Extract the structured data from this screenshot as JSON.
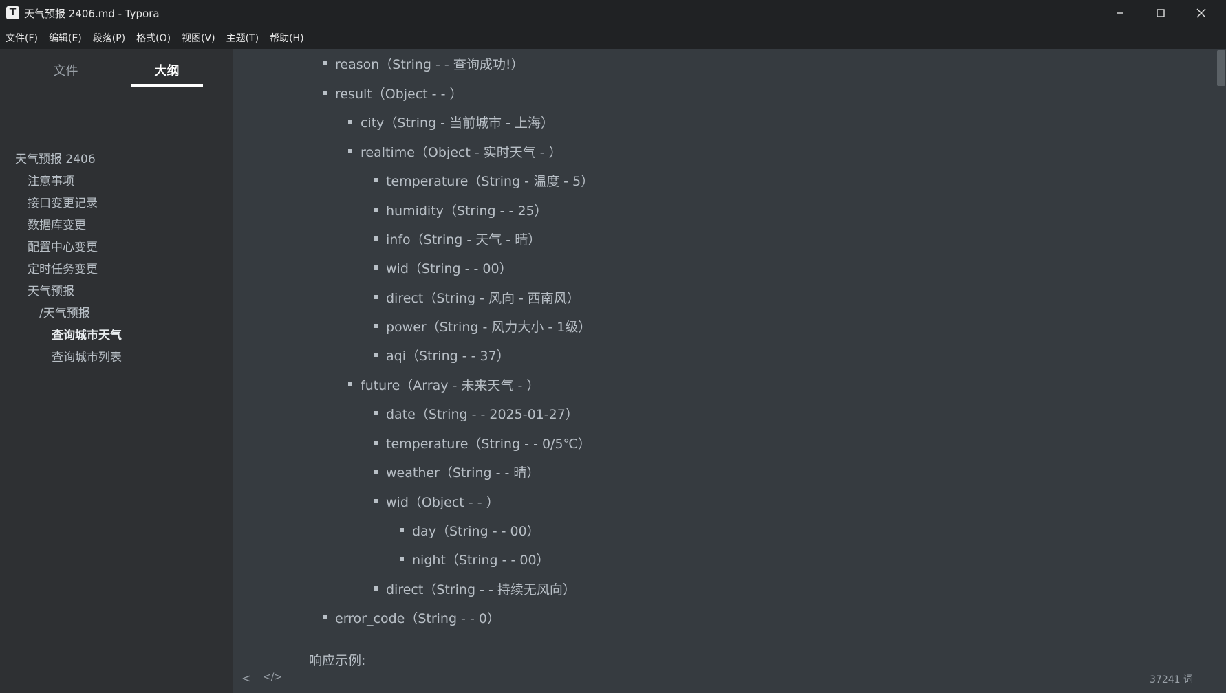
{
  "window": {
    "app_icon_letter": "T",
    "title": "天气预报 2406.md - Typora"
  },
  "menu": [
    "文件(F)",
    "编辑(E)",
    "段落(P)",
    "格式(O)",
    "视图(V)",
    "主题(T)",
    "帮助(H)"
  ],
  "sidebar": {
    "tabs": [
      {
        "label": "文件",
        "active": false
      },
      {
        "label": "大纲",
        "active": true
      }
    ],
    "outline": [
      {
        "label": "天气预报 2406",
        "level": 1,
        "active": false
      },
      {
        "label": "注意事项",
        "level": 2,
        "active": false
      },
      {
        "label": "接口变更记录",
        "level": 2,
        "active": false
      },
      {
        "label": "数据库变更",
        "level": 2,
        "active": false
      },
      {
        "label": "配置中心变更",
        "level": 2,
        "active": false
      },
      {
        "label": "定时任务变更",
        "level": 2,
        "active": false
      },
      {
        "label": "天气预报",
        "level": 2,
        "active": false
      },
      {
        "label": "/天气预报",
        "level": 3,
        "active": false
      },
      {
        "label": "查询城市天气",
        "level": 4,
        "active": true
      },
      {
        "label": "查询城市列表",
        "level": 4,
        "active": false
      }
    ]
  },
  "document": {
    "items": [
      {
        "text": "reason（String -  - 查询成功!）",
        "level": 1
      },
      {
        "text": "result（Object -  - ）",
        "level": 1
      },
      {
        "text": "city（String - 当前城市 - 上海）",
        "level": 2
      },
      {
        "text": "realtime（Object - 实时天气 - ）",
        "level": 2
      },
      {
        "text": "temperature（String - 温度 - 5）",
        "level": 3
      },
      {
        "text": "humidity（String -  - 25）",
        "level": 3
      },
      {
        "text": "info（String - 天气 - 晴）",
        "level": 3
      },
      {
        "text": "wid（String -  - 00）",
        "level": 3
      },
      {
        "text": "direct（String - 风向 - 西南风）",
        "level": 3
      },
      {
        "text": "power（String - 风力大小 - 1级）",
        "level": 3
      },
      {
        "text": "aqi（String -  - 37）",
        "level": 3
      },
      {
        "text": "future（Array - 未来天气 - ）",
        "level": 2
      },
      {
        "text": "date（String -  - 2025-01-27）",
        "level": 3
      },
      {
        "text": "temperature（String -  - 0/5℃）",
        "level": 3
      },
      {
        "text": "weather（String -  - 晴）",
        "level": 3
      },
      {
        "text": "wid（Object -  - ）",
        "level": 3
      },
      {
        "text": "day（String -  - 00）",
        "level": 4
      },
      {
        "text": "night（String -  - 00）",
        "level": 4
      },
      {
        "text": "direct（String -  - 持续无风向）",
        "level": 3
      },
      {
        "text": "error_code（String -  - 0）",
        "level": 1
      }
    ],
    "response_example_label": "响应示例:"
  },
  "footer": {
    "back_glyph": "<",
    "source_glyph": "</>",
    "word_count": "37241 词"
  }
}
